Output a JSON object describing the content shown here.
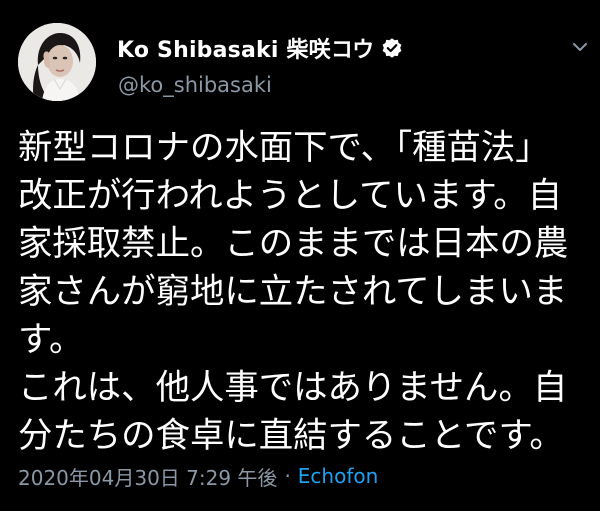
{
  "tweet": {
    "author": {
      "display_name": "Ko Shibasaki  柴咲コウ",
      "handle": "@ko_shibasaki",
      "verified": true
    },
    "text_lines": [
      "新型コロナの水面下で、「種苗法」",
      "改正が行われようとしています。自",
      "家採取禁止。このままでは日本の農",
      "家さんが窮地に立たされてしまいま",
      "す。",
      "これは、他人事ではありません。自",
      "分たちの食卓に直結することです。"
    ],
    "timestamp": "2020年04月30日 7:29 午後",
    "separator": "·",
    "source": "Echofon"
  },
  "icons": {
    "verified": "verified-badge-icon",
    "menu": "chevron-down-icon"
  },
  "colors": {
    "background": "#000000",
    "text": "#ffffff",
    "secondary_text": "#8b98a5",
    "link": "#1da1f2"
  }
}
